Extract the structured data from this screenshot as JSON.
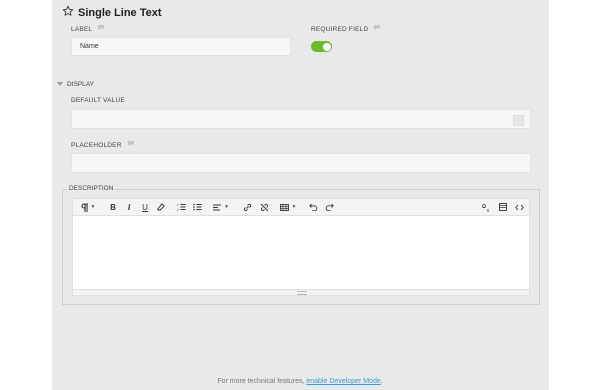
{
  "field": {
    "title": "Single Line Text"
  },
  "label_field": {
    "label": "LABEL",
    "value": "Name"
  },
  "required_field": {
    "label": "REQUIRED FIELD",
    "enabled": true,
    "color": "#6bbb2c"
  },
  "display_section": {
    "label": "DISPLAY"
  },
  "default_value": {
    "label": "DEFAULT VALUE",
    "value": ""
  },
  "placeholder_field": {
    "label": "PLACEHOLDER",
    "value": ""
  },
  "description": {
    "legend": "DESCRIPTION",
    "toolbar": [
      "paragraph-format-icon",
      "bold-icon",
      "italic-icon",
      "underline-icon",
      "clear-format-icon",
      "ordered-list-icon",
      "unordered-list-icon",
      "align-icon",
      "insert-link-icon",
      "unlink-icon",
      "insert-table-icon",
      "undo-icon",
      "redo-icon",
      "special-characters-icon",
      "fullscreen-icon",
      "code-view-icon"
    ],
    "content": ""
  },
  "footer": {
    "text": "For more technical features, ",
    "link": "enable Developer Mode",
    "suffix": "."
  }
}
